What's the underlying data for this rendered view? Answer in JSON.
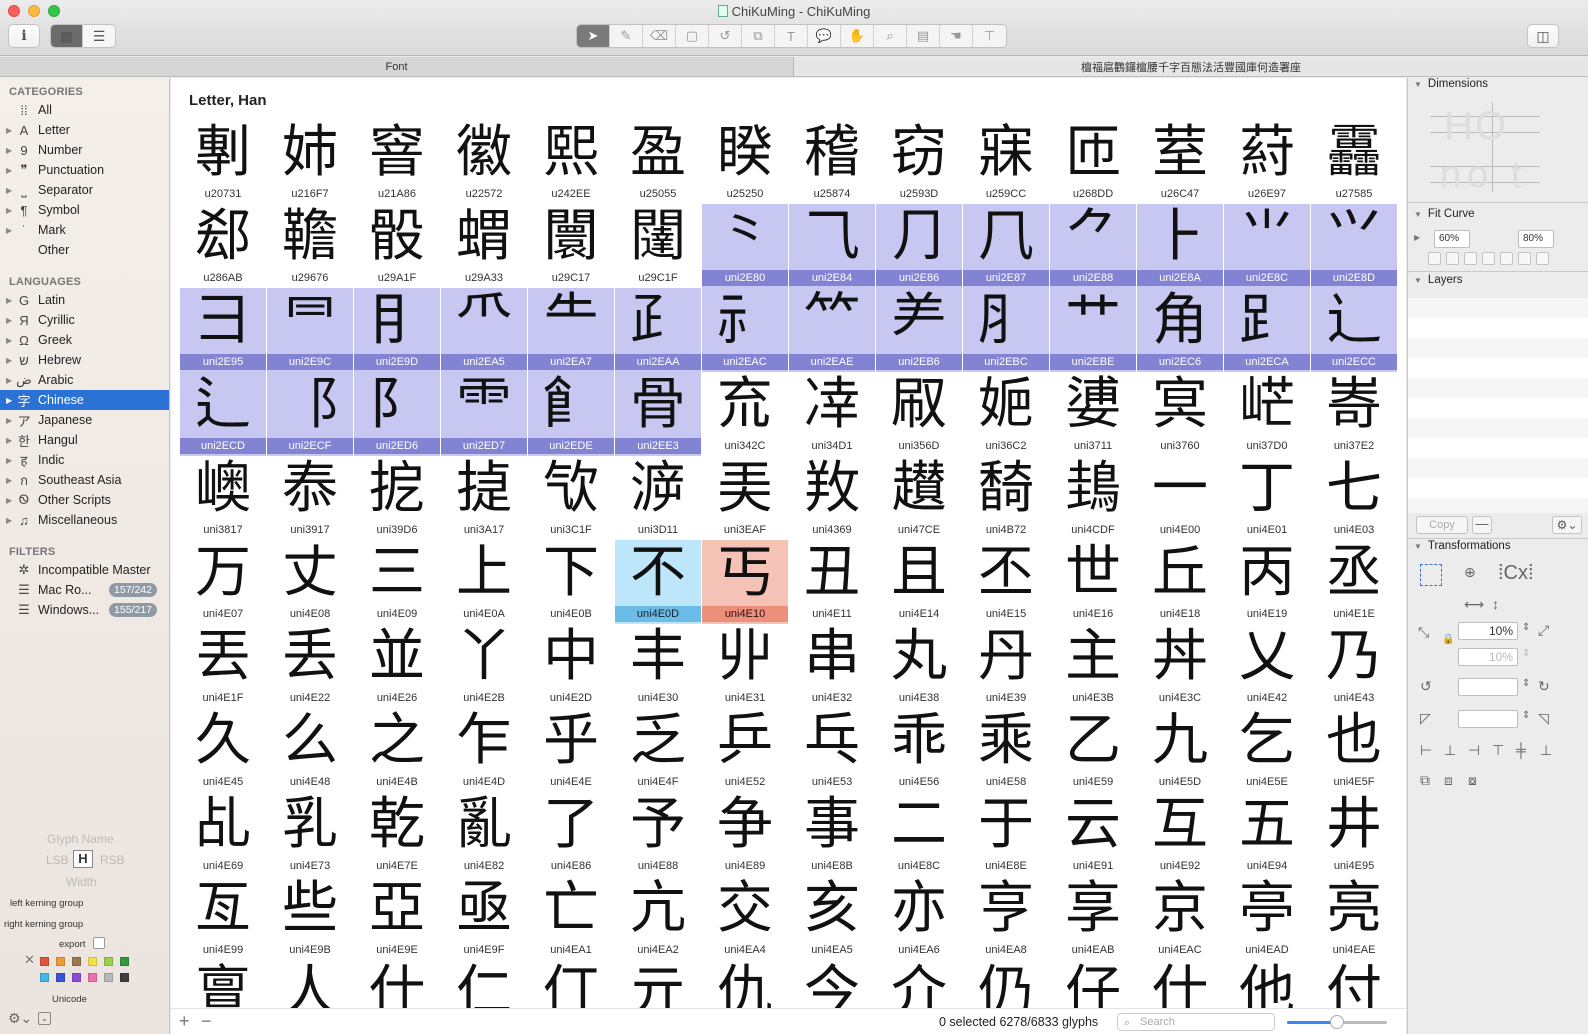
{
  "window": {
    "title": "ChiKuMing - ChiKuMing"
  },
  "toolbar": {
    "info_icon": "i",
    "grid_view_icon": "▦",
    "list_view_icon": "☰",
    "sidebar_toggle_icon": "◫",
    "tools": [
      "➤",
      "✎",
      "⌫",
      "▢",
      "↺",
      "⧉",
      "T",
      "💬",
      "✋",
      "⌕",
      "▤",
      "☚",
      "⊤"
    ]
  },
  "tabs": {
    "font": "Font",
    "text": "檀福扈鸜鑼檀腰千字百態法活豐國庫何造署座"
  },
  "sidebar": {
    "categories_heading": "CATEGORIES",
    "categories": [
      {
        "label": "All",
        "icon": "⁞⁞",
        "arrow": ""
      },
      {
        "label": "Letter",
        "icon": "A",
        "arrow": "▶"
      },
      {
        "label": "Number",
        "icon": "9",
        "arrow": "▶"
      },
      {
        "label": "Punctuation",
        "icon": "❞",
        "arrow": "▶"
      },
      {
        "label": "Separator",
        "icon": "⎵",
        "arrow": "▶"
      },
      {
        "label": "Symbol",
        "icon": "¶",
        "arrow": "▶"
      },
      {
        "label": "Mark",
        "icon": "˙",
        "arrow": "▶"
      },
      {
        "label": "Other",
        "icon": "",
        "arrow": ""
      }
    ],
    "languages_heading": "LANGUAGES",
    "languages": [
      {
        "label": "Latin",
        "icon": "G",
        "arrow": "▶"
      },
      {
        "label": "Cyrillic",
        "icon": "Я",
        "arrow": "▶"
      },
      {
        "label": "Greek",
        "icon": "Ω",
        "arrow": "▶"
      },
      {
        "label": "Hebrew",
        "icon": "ש",
        "arrow": "▶"
      },
      {
        "label": "Arabic",
        "icon": "ض",
        "arrow": "▶"
      },
      {
        "label": "Chinese",
        "icon": "字",
        "arrow": "▶",
        "selected": true
      },
      {
        "label": "Japanese",
        "icon": "ア",
        "arrow": "▶"
      },
      {
        "label": "Hangul",
        "icon": "한",
        "arrow": "▶"
      },
      {
        "label": "Indic",
        "icon": "ह",
        "arrow": "▶"
      },
      {
        "label": "Southeast Asia",
        "icon": "ก",
        "arrow": "▶"
      },
      {
        "label": "Other Scripts",
        "icon": "Ꮻ",
        "arrow": "▶"
      },
      {
        "label": "Miscellaneous",
        "icon": "♫",
        "arrow": "▶"
      }
    ],
    "filters_heading": "FILTERS",
    "filters": [
      {
        "label": "Incompatible Master",
        "icon": "✲",
        "badge": ""
      },
      {
        "label": "Mac Ro...",
        "icon": "☰",
        "badge": "157/242"
      },
      {
        "label": "Windows...",
        "icon": "☰",
        "badge": "155/217"
      }
    ],
    "glyph_info": {
      "glyph_name_placeholder": "Glyph Name",
      "lsb": "LSB",
      "rsb": "RSB",
      "width": "Width",
      "left_kerning": "left kerning group",
      "right_kerning": "right kerning group",
      "export_label": "export",
      "unicode_label": "Unicode",
      "swatch_colors": [
        "#e0533c",
        "#ef9a3a",
        "#9c7a49",
        "#f2e247",
        "#9bd14d",
        "#2f9b3a",
        "#43b6e8",
        "#3a54d6",
        "#8a4fd6",
        "#ee6fb0",
        "#b8b8b8",
        "#3f3f3f"
      ]
    }
  },
  "main": {
    "section_title": "Letter, Han",
    "status": "0 selected 6278/6833 glyphs",
    "search_placeholder": "Search",
    "zoom_slider_level": 0.5,
    "glyphs": [
      {
        "c": "剸",
        "n": "u20731"
      },
      {
        "c": "姉",
        "n": "u216F7"
      },
      {
        "c": "窨",
        "n": "u21A86"
      },
      {
        "c": "徽",
        "n": "u22572"
      },
      {
        "c": "熙",
        "n": "u242EE"
      },
      {
        "c": "盈",
        "n": "u25055"
      },
      {
        "c": "睽",
        "n": "u25250"
      },
      {
        "c": "稽",
        "n": "u25874"
      },
      {
        "c": "窃",
        "n": "u2593D"
      },
      {
        "c": "寐",
        "n": "u259CC"
      },
      {
        "c": "匝",
        "n": "u268DD"
      },
      {
        "c": "荎",
        "n": "u26C47"
      },
      {
        "c": "葤",
        "n": "u26E97"
      },
      {
        "c": "靐",
        "n": "u27585"
      },
      {
        "c": "郄",
        "n": "u286AB"
      },
      {
        "c": "韂",
        "n": "u29676"
      },
      {
        "c": "骰",
        "n": "u29A1F"
      },
      {
        "c": "蝟",
        "n": "u29A33"
      },
      {
        "c": "闤",
        "n": "u29C17"
      },
      {
        "c": "闥",
        "n": "u29C1F"
      },
      {
        "c": "⺀",
        "n": "uni2E80",
        "hl": "blue"
      },
      {
        "c": "⺄",
        "n": "uni2E84",
        "hl": "blue"
      },
      {
        "c": "⺆",
        "n": "uni2E86",
        "hl": "blue"
      },
      {
        "c": "⺇",
        "n": "uni2E87",
        "hl": "blue"
      },
      {
        "c": "⺈",
        "n": "uni2E88",
        "hl": "blue"
      },
      {
        "c": "⺊",
        "n": "uni2E8A",
        "hl": "blue"
      },
      {
        "c": "⺌",
        "n": "uni2E8C",
        "hl": "blue"
      },
      {
        "c": "⺍",
        "n": "uni2E8D",
        "hl": "blue"
      },
      {
        "c": "⺕",
        "n": "uni2E95",
        "hl": "blue"
      },
      {
        "c": "⺜",
        "n": "uni2E9C",
        "hl": "blue"
      },
      {
        "c": "⺝",
        "n": "uni2E9D",
        "hl": "blue"
      },
      {
        "c": "⺥",
        "n": "uni2EA5",
        "hl": "blue"
      },
      {
        "c": "⺧",
        "n": "uni2EA7",
        "hl": "blue"
      },
      {
        "c": "⺪",
        "n": "uni2EAA",
        "hl": "blue"
      },
      {
        "c": "⺬",
        "n": "uni2EAC",
        "hl": "blue"
      },
      {
        "c": "⺮",
        "n": "uni2EAE",
        "hl": "blue"
      },
      {
        "c": "⺶",
        "n": "uni2EB6",
        "hl": "blue"
      },
      {
        "c": "⺼",
        "n": "uni2EBC",
        "hl": "blue"
      },
      {
        "c": "⺾",
        "n": "uni2EBE",
        "hl": "blue"
      },
      {
        "c": "⻆",
        "n": "uni2EC6",
        "hl": "blue"
      },
      {
        "c": "⻊",
        "n": "uni2ECA",
        "hl": "blue"
      },
      {
        "c": "⻌",
        "n": "uni2ECC",
        "hl": "blue"
      },
      {
        "c": "⻍",
        "n": "uni2ECD",
        "hl": "blue"
      },
      {
        "c": "⻏",
        "n": "uni2ECF",
        "hl": "blue"
      },
      {
        "c": "⻖",
        "n": "uni2ED6",
        "hl": "blue"
      },
      {
        "c": "⻗",
        "n": "uni2ED7",
        "hl": "blue"
      },
      {
        "c": "⻞",
        "n": "uni2EDE",
        "hl": "blue"
      },
      {
        "c": "⻣",
        "n": "uni2EE3",
        "hl": "blue"
      },
      {
        "c": "㐬",
        "n": "uni342C"
      },
      {
        "c": "㓑",
        "n": "uni34D1"
      },
      {
        "c": "㕞",
        "n": "uni356D"
      },
      {
        "c": "㛂",
        "n": "uni36C2"
      },
      {
        "c": "㜑",
        "n": "uni3711"
      },
      {
        "c": "㝠",
        "n": "uni3760"
      },
      {
        "c": "㟐",
        "n": "uni37D0"
      },
      {
        "c": "㟢",
        "n": "uni37E2"
      },
      {
        "c": "㠗",
        "n": "uni3817"
      },
      {
        "c": "㤗",
        "n": "uni3917"
      },
      {
        "c": "㧖",
        "n": "uni39D6"
      },
      {
        "c": "㨗",
        "n": "uni3A17"
      },
      {
        "c": "㰟",
        "n": "uni3C1F"
      },
      {
        "c": "㴑",
        "n": "uni3D11"
      },
      {
        "c": "㺯",
        "n": "uni3EAF"
      },
      {
        "c": "䍩",
        "n": "uni4369"
      },
      {
        "c": "䟎",
        "n": "uni47CE"
      },
      {
        "c": "䭲",
        "n": "uni4B72"
      },
      {
        "c": "䳏",
        "n": "uni4CDF"
      },
      {
        "c": "一",
        "n": "uni4E00"
      },
      {
        "c": "丁",
        "n": "uni4E01"
      },
      {
        "c": "七",
        "n": "uni4E03"
      },
      {
        "c": "万",
        "n": "uni4E07"
      },
      {
        "c": "丈",
        "n": "uni4E08"
      },
      {
        "c": "三",
        "n": "uni4E09"
      },
      {
        "c": "上",
        "n": "uni4E0A"
      },
      {
        "c": "下",
        "n": "uni4E0B"
      },
      {
        "c": "不",
        "n": "uni4E0D",
        "hl": "cyan"
      },
      {
        "c": "丐",
        "n": "uni4E10",
        "hl": "salmon"
      },
      {
        "c": "丑",
        "n": "uni4E11"
      },
      {
        "c": "且",
        "n": "uni4E14"
      },
      {
        "c": "丕",
        "n": "uni4E15"
      },
      {
        "c": "世",
        "n": "uni4E16"
      },
      {
        "c": "丘",
        "n": "uni4E18"
      },
      {
        "c": "丙",
        "n": "uni4E19"
      },
      {
        "c": "丞",
        "n": "uni4E1E"
      },
      {
        "c": "丟",
        "n": "uni4E1F"
      },
      {
        "c": "丢",
        "n": "uni4E22"
      },
      {
        "c": "並",
        "n": "uni4E26"
      },
      {
        "c": "丫",
        "n": "uni4E2B"
      },
      {
        "c": "中",
        "n": "uni4E2D"
      },
      {
        "c": "丰",
        "n": "uni4E30"
      },
      {
        "c": "丱",
        "n": "uni4E31"
      },
      {
        "c": "串",
        "n": "uni4E32"
      },
      {
        "c": "丸",
        "n": "uni4E38"
      },
      {
        "c": "丹",
        "n": "uni4E39"
      },
      {
        "c": "主",
        "n": "uni4E3B"
      },
      {
        "c": "丼",
        "n": "uni4E3C"
      },
      {
        "c": "乂",
        "n": "uni4E42"
      },
      {
        "c": "乃",
        "n": "uni4E43"
      },
      {
        "c": "久",
        "n": "uni4E45"
      },
      {
        "c": "么",
        "n": "uni4E48"
      },
      {
        "c": "之",
        "n": "uni4E4B"
      },
      {
        "c": "乍",
        "n": "uni4E4D"
      },
      {
        "c": "乎",
        "n": "uni4E4E"
      },
      {
        "c": "乏",
        "n": "uni4E4F"
      },
      {
        "c": "乒",
        "n": "uni4E52"
      },
      {
        "c": "乓",
        "n": "uni4E53"
      },
      {
        "c": "乖",
        "n": "uni4E56"
      },
      {
        "c": "乘",
        "n": "uni4E58"
      },
      {
        "c": "乙",
        "n": "uni4E59"
      },
      {
        "c": "九",
        "n": "uni4E5D"
      },
      {
        "c": "乞",
        "n": "uni4E5E"
      },
      {
        "c": "也",
        "n": "uni4E5F"
      },
      {
        "c": "乩",
        "n": "uni4E69"
      },
      {
        "c": "乳",
        "n": "uni4E73"
      },
      {
        "c": "乾",
        "n": "uni4E7E"
      },
      {
        "c": "亂",
        "n": "uni4E82"
      },
      {
        "c": "了",
        "n": "uni4E86"
      },
      {
        "c": "予",
        "n": "uni4E88"
      },
      {
        "c": "争",
        "n": "uni4E89"
      },
      {
        "c": "事",
        "n": "uni4E8B"
      },
      {
        "c": "二",
        "n": "uni4E8C"
      },
      {
        "c": "于",
        "n": "uni4E8E"
      },
      {
        "c": "云",
        "n": "uni4E91"
      },
      {
        "c": "互",
        "n": "uni4E92"
      },
      {
        "c": "五",
        "n": "uni4E94"
      },
      {
        "c": "井",
        "n": "uni4E95"
      },
      {
        "c": "亙",
        "n": "uni4E99"
      },
      {
        "c": "些",
        "n": "uni4E9B"
      },
      {
        "c": "亞",
        "n": "uni4E9E"
      },
      {
        "c": "亟",
        "n": "uni4E9F"
      },
      {
        "c": "亡",
        "n": "uni4EA1"
      },
      {
        "c": "亢",
        "n": "uni4EA2"
      },
      {
        "c": "交",
        "n": "uni4EA4"
      },
      {
        "c": "亥",
        "n": "uni4EA5"
      },
      {
        "c": "亦",
        "n": "uni4EA6"
      },
      {
        "c": "亨",
        "n": "uni4EA8"
      },
      {
        "c": "享",
        "n": "uni4EAB"
      },
      {
        "c": "京",
        "n": "uni4EAC"
      },
      {
        "c": "亭",
        "n": "uni4EAD"
      },
      {
        "c": "亮",
        "n": "uni4EAE"
      },
      {
        "c": "亶",
        "n": ""
      },
      {
        "c": "人",
        "n": ""
      },
      {
        "c": "仕",
        "n": ""
      },
      {
        "c": "仁",
        "n": ""
      },
      {
        "c": "仃",
        "n": ""
      },
      {
        "c": "亓",
        "n": ""
      },
      {
        "c": "仇",
        "n": ""
      },
      {
        "c": "今",
        "n": ""
      },
      {
        "c": "介",
        "n": ""
      },
      {
        "c": "仍",
        "n": ""
      },
      {
        "c": "仔",
        "n": ""
      },
      {
        "c": "仕",
        "n": ""
      },
      {
        "c": "他",
        "n": ""
      },
      {
        "c": "付",
        "n": ""
      }
    ]
  },
  "right_panel": {
    "dimensions_label": "Dimensions",
    "dimensions_preview_top": "HO",
    "dimensions_preview_bottom": "no t",
    "fit_curve_label": "Fit Curve",
    "fit_curve_min": "60%",
    "fit_curve_max": "80%",
    "layers_label": "Layers",
    "copy_label": "Copy",
    "minus_label": "—",
    "gear_label": "⚙⌄",
    "transformations_label": "Transformations",
    "scale_x": "10%",
    "scale_y": "10%",
    "rotate_value": "",
    "slant_value": ""
  }
}
